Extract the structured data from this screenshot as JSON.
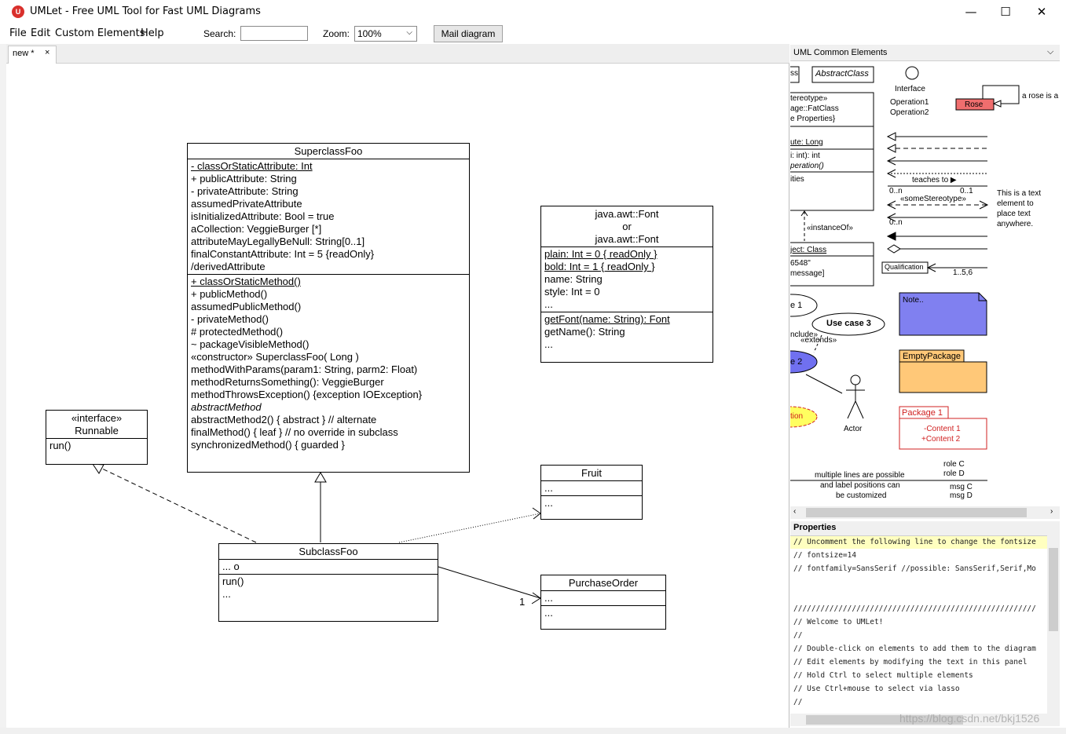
{
  "window": {
    "title": "UMLet - Free UML Tool for Fast UML Diagrams",
    "minimize": "—",
    "maximize": "☐",
    "close": "✕"
  },
  "menu": {
    "file": "File",
    "edit": "Edit",
    "custom": "Custom Elements",
    "help": "Help",
    "search_label": "Search:",
    "search_value": "",
    "zoom_label": "Zoom:",
    "zoom_value": "100%",
    "mail_button": "Mail diagram"
  },
  "tab": {
    "label": "new *",
    "close": "×"
  },
  "diagram": {
    "superclass": {
      "name": "SuperclassFoo",
      "attributes": [
        "- classOrStaticAttribute: Int",
        "+ publicAttribute: String",
        "- privateAttribute: String",
        "assumedPrivateAttribute",
        "isInitializedAttribute: Bool = true",
        "aCollection: VeggieBurger [*]",
        "attributeMayLegallyBeNull: String[0..1]",
        "finalConstantAttribute: Int = 5 {readOnly}",
        "/derivedAttribute"
      ],
      "methods": [
        "+ classOrStaticMethod()",
        "+ publicMethod()",
        "assumedPublicMethod()",
        "- privateMethod()",
        "# protectedMethod()",
        "~ packageVisibleMethod()",
        "«constructor» SuperclassFoo( Long )",
        "methodWithParams(param1: String, parm2: Float)",
        "methodReturnsSomething(): VeggieBurger",
        "methodThrowsException() {exception IOException}",
        "abstractMethod",
        "abstractMethod2() { abstract }   // alternate",
        "finalMethod() { leaf } // no override in subclass",
        "synchronizedMethod() { guarded }"
      ]
    },
    "font": {
      "name_lines": [
        "java.awt::Font",
        "or",
        "java.awt::Font"
      ],
      "attributes": [
        "plain: Int = 0 { readOnly }",
        "bold: Int = 1 { readOnly }",
        "name: String",
        "style: Int = 0",
        "..."
      ],
      "methods": [
        "getFont(name: String): Font",
        "getName(): String",
        "..."
      ]
    },
    "runnable": {
      "stereotype": "«interface»",
      "name": "Runnable",
      "methods": [
        "run()"
      ]
    },
    "fruit": {
      "name": "Fruit",
      "attrs": "...",
      "methods": "..."
    },
    "subclass": {
      "name": "SubclassFoo",
      "attrs": "...     o",
      "methods": [
        "run()",
        "..."
      ]
    },
    "purchase": {
      "name": "PurchaseOrder",
      "attrs": "...",
      "methods": "...",
      "multiplicity": "1"
    }
  },
  "palette": {
    "title": "UML Common Elements",
    "items": {
      "class_frag": "ss",
      "abstract_class": "AbstractClass",
      "interface_label": "Interface",
      "interface_ops": [
        "Operation1",
        "Operation2"
      ],
      "rose": "Rose",
      "rose_note": "a rose is a",
      "fatclass_lines": [
        "tereotype»",
        "age::FatClass",
        "e Properties}"
      ],
      "fatclass_attr": "ute: Long",
      "fatclass_ops": [
        "i: int): int",
        "peration()"
      ],
      "fatclass_resp": "ities",
      "instance_of": "«instanceOf»",
      "object_name": "ject: Class",
      "object_lines": [
        "6548\"",
        "message]"
      ],
      "teaches": "teaches to ▶",
      "mult_a": "0..n",
      "mult_b": "0..1",
      "some_stereotype": "«someStereotype»",
      "mult_c": "0..n",
      "text_element": [
        "This is a text",
        "element to",
        "place text",
        "anywhere."
      ],
      "qualification": "Qualification",
      "q_mult": "1..5,6",
      "usecase1": "e 1",
      "usecase3": "Use case 3",
      "include": "nclude»",
      "extends": "«extends»",
      "usecase2": "e 2",
      "note": "Note..",
      "empty_package": "EmptyPackage",
      "actor": "Actor",
      "condition": "tion",
      "package1": "Package 1",
      "package_contents": [
        "-Content 1",
        "+Content 2"
      ],
      "multiline": [
        "multiple lines are possible",
        "and label positions can",
        "be customized"
      ],
      "roles": [
        "role C",
        "role D"
      ],
      "msgs": [
        "msg C",
        "msg D"
      ]
    }
  },
  "properties": {
    "title": "Properties",
    "lines": [
      "// Uncomment the following line to change the fontsize",
      "// fontsize=14",
      "// fontfamily=SansSerif //possible: SansSerif,Serif,Mo",
      "",
      "",
      "//////////////////////////////////////////////////////",
      "// Welcome to UMLet!",
      "//",
      "// Double-click on elements to add them to the diagram",
      "// Edit elements by modifying the text in this panel",
      "// Hold Ctrl to select multiple elements",
      "// Use Ctrl+mouse to select via lasso",
      "//"
    ]
  },
  "watermark": "https://blog.csdn.net/bkj1526",
  "colors": {
    "highlight": "#ffffc0",
    "rose": "#f06e6e",
    "note": "#8080f0",
    "package": "#ffc878",
    "package1_text": "#d02020",
    "condition": "#ffff60",
    "usecase2": "#7070f0"
  }
}
